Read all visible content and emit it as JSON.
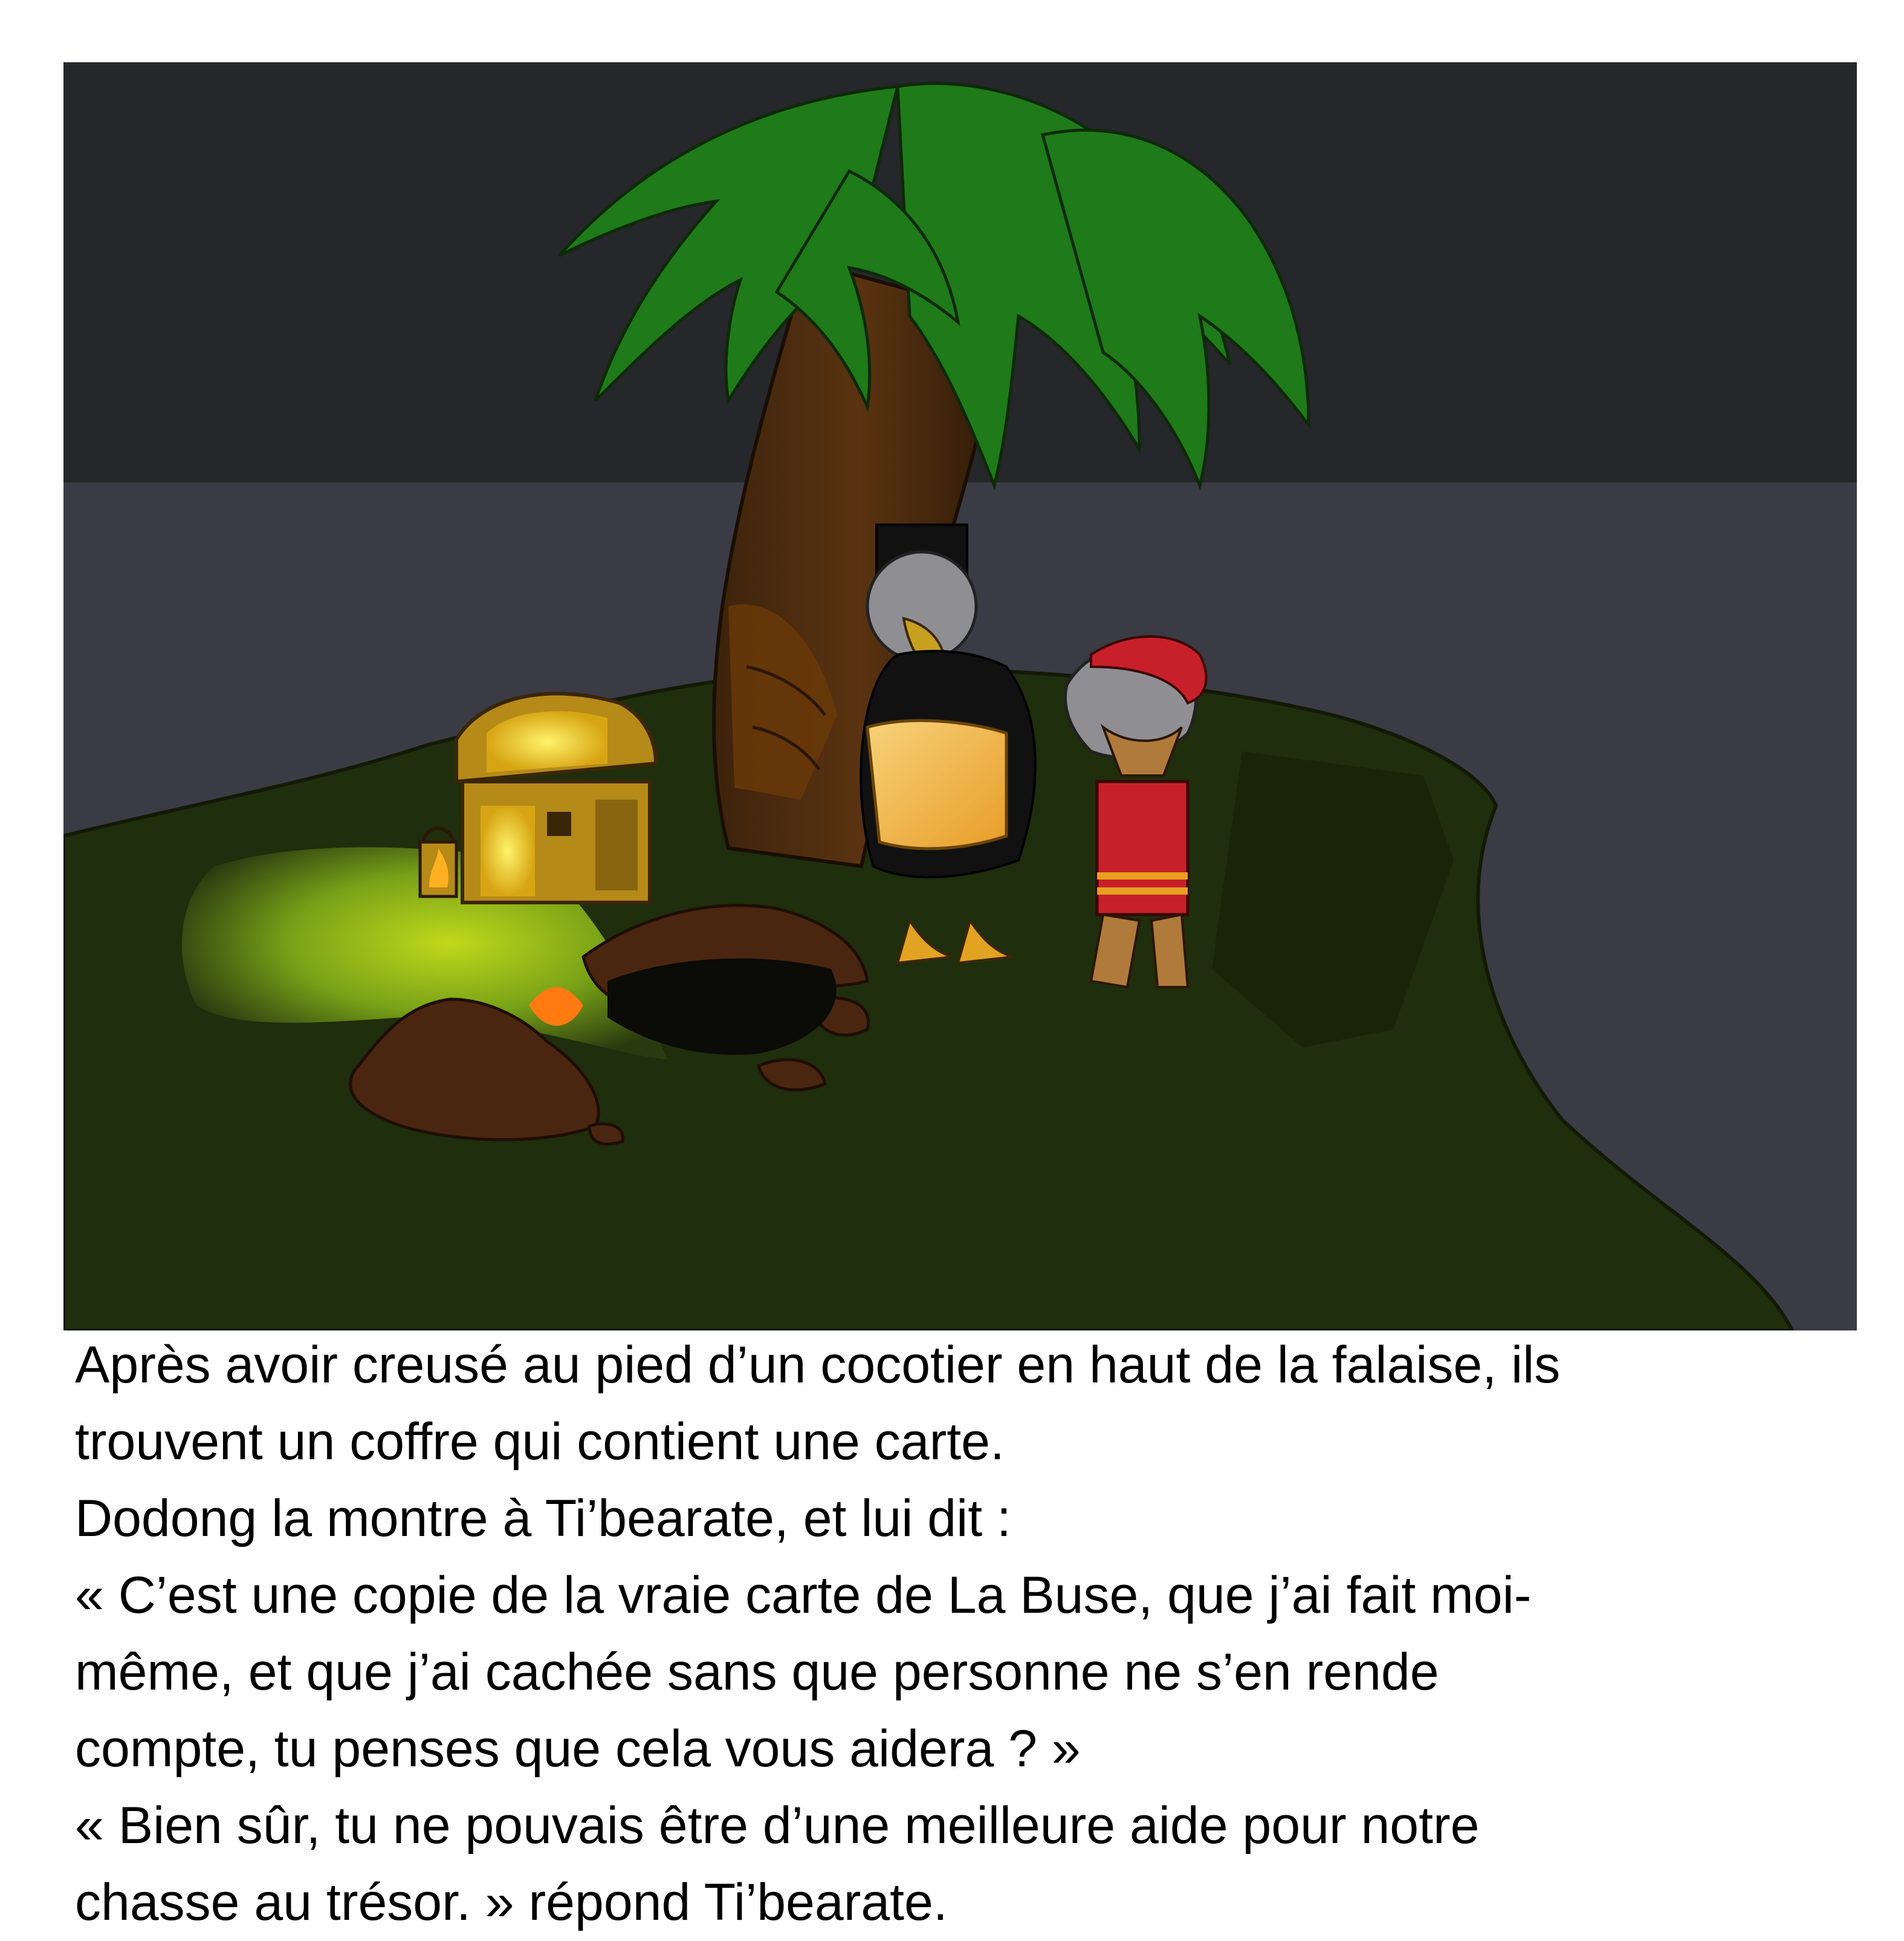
{
  "caption": {
    "lines": [
      "Après avoir creusé au pied d’un cocotier en haut de la falaise, ils",
      "trouvent un coffre qui contient une carte.",
      "Dodong la montre à Ti’bearate, et lui dit :",
      "« C’est une copie de la vraie carte de La Buse, que j’ai fait moi-",
      "même, et que j’ai cachée sans que personne ne s’en rende",
      "compte, tu penses que cela vous aidera ? »",
      "« Bien sûr, tu ne pouvais être d’une meilleure aide pour notre",
      "chasse au trésor. » répond Ti’bearate."
    ]
  },
  "illustration": {
    "scene": "night-island-treasure-dig",
    "colors": {
      "sky": "#25272a",
      "sea": "#3a3b44",
      "island": "#1f2e0c",
      "island_lit": "#9ec61c",
      "palm_leaves": "#1f7a1a",
      "trunk": "#4a2a0d",
      "chest": "#b58a18",
      "chest_glow": "#ffe84a",
      "dirt": "#4a2610",
      "lantern_flame": "#ffb020",
      "vulture_body": "#8f8f93",
      "bear_fur": "#8f8f93",
      "bandana": "#c8202a",
      "map": "#f0b840"
    }
  }
}
